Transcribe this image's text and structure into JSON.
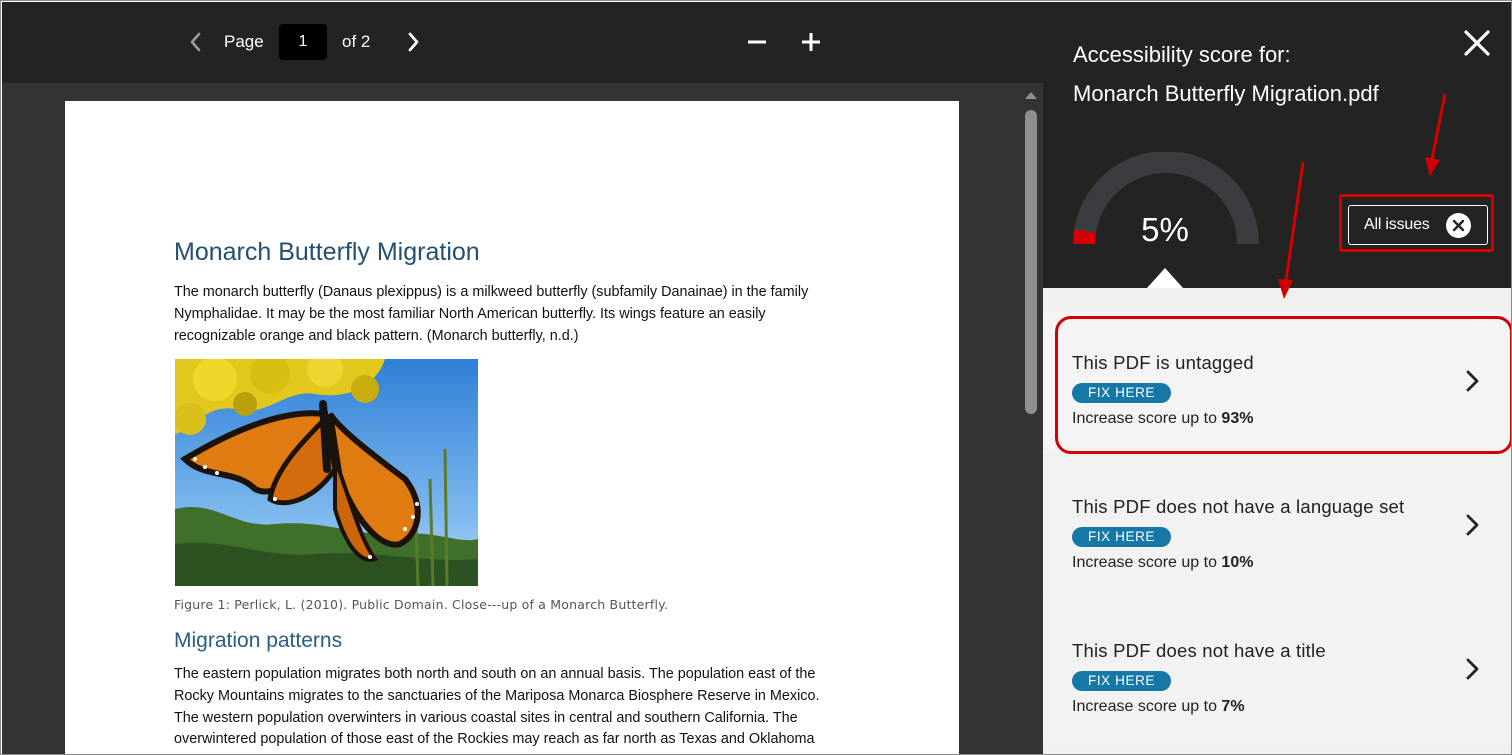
{
  "toolbar": {
    "prev_icon": "chevron-left-icon",
    "page_label": "Page",
    "page_value": "1",
    "of_label": "of 2",
    "next_icon": "chevron-right-icon",
    "zoom_out_icon": "minus-icon",
    "zoom_in_icon": "plus-icon"
  },
  "document": {
    "title": "Monarch Butterfly Migration",
    "para1": [
      "The monarch butterfly (Danaus plexippus) is a milkweed butterfly (subfamily Danainae) in the family",
      "Nymphalidae. It may be the most familiar North American butterfly. Its wings feature an easily",
      "recognizable orange and black pattern. (Monarch  butterfly, n.d.)"
    ],
    "caption": "Figure 1: Perlick, L. (2010). Public Domain. Close---up of a Monarch Butterfly.",
    "section_heading": "Migration patterns",
    "para2": [
      "The eastern population migrates both north and south on an annual basis. The population east of the",
      "Rocky Mountains migrates to the sanctuaries of the Mariposa Monarca Biosphere Reserve in Mexico.",
      "The western population overwinters in various coastal sites in central and southern California. The",
      "overwintered population of those east of the Rockies may reach as far north as Texas and Oklahoma"
    ]
  },
  "panel": {
    "heading_line1": "Accessibility score for:",
    "heading_line2": "Monarch Butterfly Migration.pdf",
    "close_icon": "close-icon",
    "score_text": "5%",
    "score_value": 5,
    "all_issues_label": "All issues",
    "issues": [
      {
        "title": "This PDF is untagged",
        "badge": "FIX HERE",
        "increase_prefix": "Increase score up to",
        "increase_value": "93%"
      },
      {
        "title": "This PDF does not have a language set",
        "badge": "FIX HERE",
        "increase_prefix": "Increase score up to",
        "increase_value": "10%"
      },
      {
        "title": "This PDF does not have a title",
        "badge": "FIX HERE",
        "increase_prefix": "Increase score up to",
        "increase_value": "7%"
      }
    ]
  },
  "colors": {
    "header_bg": "#232323",
    "viewer_bg": "#333333",
    "panel_bg": "#f2f2f2",
    "gauge_track": "#3c3c40",
    "gauge_fill": "#d40000",
    "badge_bg": "#1578a6",
    "annotation_red": "#d40000",
    "doc_title": "#23506f"
  }
}
